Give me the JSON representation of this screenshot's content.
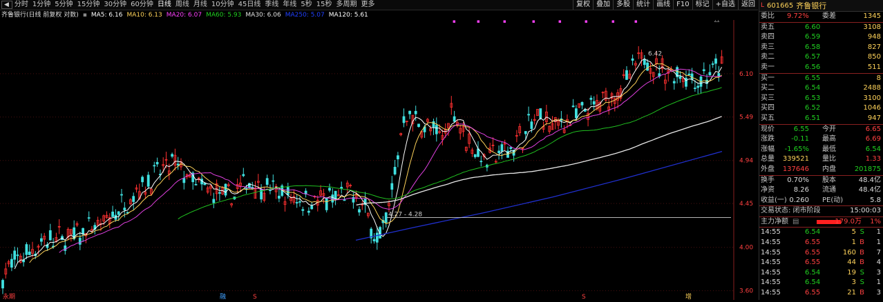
{
  "toolbar": {
    "back_label": "◀",
    "periods": [
      "分时",
      "1分钟",
      "5分钟",
      "15分钟",
      "30分钟",
      "60分钟",
      "日线",
      "周线",
      "月线",
      "10分钟",
      "45日线",
      "季线",
      "年线",
      "5秒",
      "15秒",
      "多周期",
      "更多"
    ],
    "active_period": "日线",
    "more_label": "更多 >",
    "right_buttons": [
      "复权",
      "叠加",
      "多股",
      "统计",
      "画线",
      "F10",
      "标记",
      "+自选",
      "返回"
    ]
  },
  "chart": {
    "title": "齐鲁银行(日线 前复权 对数)",
    "ma": [
      {
        "label": "MA5: 6.16",
        "color": "#ffffff"
      },
      {
        "label": "MA10: 6.13",
        "color": "#ffd35a"
      },
      {
        "label": "MA20: 6.07",
        "color": "#ff40ff"
      },
      {
        "label": "MA60: 5.93",
        "color": "#20d020"
      },
      {
        "label": "MA30: 6.06",
        "color": "#e0e0e0"
      },
      {
        "label": "MA250: 5.07",
        "color": "#2040ff"
      },
      {
        "label": "MA120: 5.61",
        "color": "#ffffff"
      }
    ],
    "y_ticks": [
      "6.10",
      "5.49",
      "4.94",
      "4.45",
      "4.00",
      "3.60"
    ],
    "high_label": "6.42",
    "low_label": "4.27 - 4.28",
    "bottom_label": "3.60",
    "date_markers": [
      {
        "label": "永期",
        "color": "#ff4040"
      },
      {
        "label": "融",
        "color": "#40a0ff"
      },
      {
        "label": "S",
        "color": "#ff4040"
      },
      {
        "label": "S",
        "color": "#ff4040"
      },
      {
        "label": "增",
        "color": "#ffd35a"
      }
    ],
    "colors": {
      "up": "#ff3030",
      "down": "#40e0e0",
      "ma250": "#2030d0",
      "ma60": "#20c020",
      "ma120": "#e8e8e8",
      "ma20": "#e040e0",
      "ma10": "#ffd35a",
      "ma5": "#ffffff"
    }
  },
  "quote": {
    "limit_mark": "L",
    "code": "601665",
    "name": "齐鲁银行",
    "webi": {
      "label": "委比",
      "value": "9.72%",
      "label2": "委差",
      "value2": "1345"
    },
    "asks": [
      {
        "label": "卖五",
        "price": "6.60",
        "vol": "3108"
      },
      {
        "label": "卖四",
        "price": "6.59",
        "vol": "948"
      },
      {
        "label": "卖三",
        "price": "6.58",
        "vol": "827"
      },
      {
        "label": "卖二",
        "price": "6.57",
        "vol": "850"
      },
      {
        "label": "卖一",
        "price": "6.56",
        "vol": "511"
      }
    ],
    "bids": [
      {
        "label": "买一",
        "price": "6.55",
        "vol": "8"
      },
      {
        "label": "买二",
        "price": "6.54",
        "vol": "2488"
      },
      {
        "label": "买三",
        "price": "6.53",
        "vol": "3100"
      },
      {
        "label": "买四",
        "price": "6.52",
        "vol": "1046"
      },
      {
        "label": "买五",
        "price": "6.51",
        "vol": "947"
      }
    ],
    "stats": [
      {
        "k1": "现价",
        "v1": "6.55",
        "c1": "green",
        "k2": "今开",
        "v2": "6.65",
        "c2": "red"
      },
      {
        "k1": "涨跌",
        "v1": "-0.11",
        "c1": "green",
        "k2": "最高",
        "v2": "6.69",
        "c2": "red"
      },
      {
        "k1": "涨幅",
        "v1": "-1.65%",
        "c1": "green",
        "k2": "最低",
        "v2": "6.54",
        "c2": "green"
      },
      {
        "k1": "总量",
        "v1": "339521",
        "c1": "yellow",
        "k2": "量比",
        "v2": "1.33",
        "c2": "red"
      },
      {
        "k1": "外盘",
        "v1": "137646",
        "c1": "red",
        "k2": "内盘",
        "v2": "201875",
        "c2": "green"
      }
    ],
    "stats2": [
      {
        "k1": "换手",
        "v1": "0.70%",
        "c1": "white",
        "k2": "股本",
        "v2": "48.4亿",
        "c2": "white"
      },
      {
        "k1": "净资",
        "v1": "8.26",
        "c1": "white",
        "k2": "流通",
        "v2": "48.4亿",
        "c2": "white"
      },
      {
        "k1": "收益(一)",
        "v1": "0.260",
        "c1": "white",
        "k2": "PE(动)",
        "v2": "5.8",
        "c2": "white"
      }
    ],
    "trade_status": {
      "label": "交易状态: 闭市阶段",
      "time": "15:00:03"
    },
    "main_flow": {
      "label": "主力净额",
      "value": "179.0万",
      "pct": "1%"
    },
    "ticks": [
      {
        "t": "14:55",
        "p": "6.54",
        "v": "5",
        "d": "S",
        "n": "1"
      },
      {
        "t": "14:55",
        "p": "6.55",
        "v": "1",
        "d": "B",
        "n": "1"
      },
      {
        "t": "14:55",
        "p": "6.55",
        "v": "160",
        "d": "B",
        "n": "7"
      },
      {
        "t": "14:55",
        "p": "6.55",
        "v": "44",
        "d": "B",
        "n": "4"
      },
      {
        "t": "14:55",
        "p": "6.54",
        "v": "19",
        "d": "S",
        "n": "3"
      },
      {
        "t": "14:55",
        "p": "6.54",
        "v": "3",
        "d": "S",
        "n": "1"
      },
      {
        "t": "14:55",
        "p": "6.55",
        "v": "21",
        "d": "B",
        "n": "3"
      }
    ]
  }
}
